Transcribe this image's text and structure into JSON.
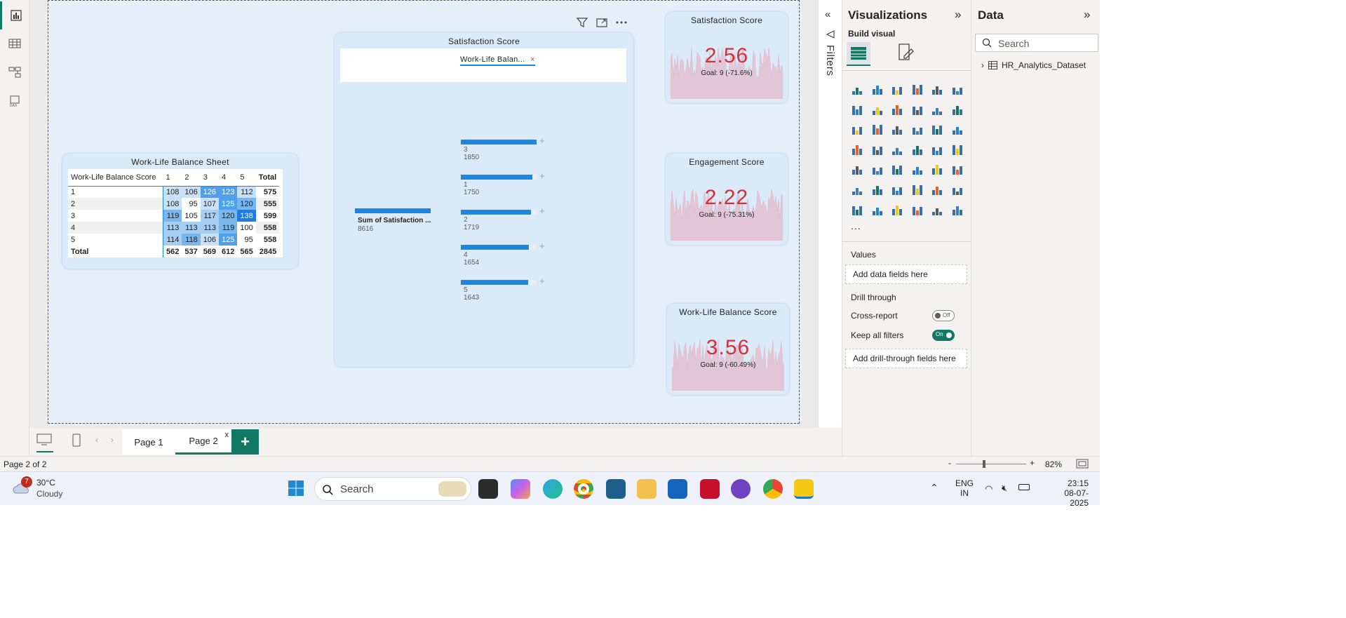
{
  "rail": {
    "items": [
      "report-view",
      "table-view",
      "model-view",
      "dax-query-view"
    ]
  },
  "canvas": {
    "matrix": {
      "title": "Work-Life Balance Sheet",
      "corner": "Work-Life Balance Score",
      "columns": [
        "1",
        "2",
        "3",
        "4",
        "5",
        "Total"
      ],
      "rows": [
        {
          "label": "1",
          "values": [
            "108",
            "106",
            "126",
            "123",
            "112"
          ],
          "total": "575"
        },
        {
          "label": "2",
          "values": [
            "108",
            "95",
            "107",
            "125",
            "120"
          ],
          "total": "555"
        },
        {
          "label": "3",
          "values": [
            "119",
            "105",
            "117",
            "120",
            "138"
          ],
          "total": "599"
        },
        {
          "label": "4",
          "values": [
            "113",
            "113",
            "113",
            "119",
            "100"
          ],
          "total": "558"
        },
        {
          "label": "5",
          "values": [
            "114",
            "118",
            "106",
            "125",
            "95"
          ],
          "total": "558"
        }
      ],
      "total_row": {
        "label": "Total",
        "values": [
          "562",
          "537",
          "569",
          "612",
          "565"
        ],
        "total": "2845"
      }
    },
    "decomp": {
      "title": "Satisfaction Score",
      "filter_chip": "Work-Life Balan...",
      "root": {
        "label": "Sum of Satisfaction ...",
        "value": "8616"
      },
      "nodes": [
        {
          "label": "3",
          "value": "1850",
          "fraction": 1.0
        },
        {
          "label": "1",
          "value": "1750",
          "fraction": 0.946
        },
        {
          "label": "2",
          "value": "1719",
          "fraction": 0.929
        },
        {
          "label": "4",
          "value": "1654",
          "fraction": 0.894
        },
        {
          "label": "5",
          "value": "1643",
          "fraction": 0.888
        }
      ]
    },
    "kpis": [
      {
        "title": "Satisfaction Score",
        "value": "2.56",
        "goal": "Goal: 9 (-71.6%)"
      },
      {
        "title": "Engagement Score",
        "value": "2.22",
        "goal": "Goal: 9 (-75.31%)"
      },
      {
        "title": "Work-Life Balance Score",
        "value": "3.56",
        "goal": "Goal: 9 (-60.49%)"
      }
    ]
  },
  "filters": {
    "label": "Filters"
  },
  "viz": {
    "title": "Visualizations",
    "build": "Build visual",
    "values_label": "Values",
    "values_placeholder": "Add data fields here",
    "drill_label": "Drill through",
    "cross_report": "Cross-report",
    "cross_state": "Off",
    "keep_filters": "Keep all filters",
    "keep_state": "On",
    "drill_placeholder": "Add drill-through fields here",
    "more": "..."
  },
  "data": {
    "title": "Data",
    "search_placeholder": "Search",
    "dataset": "HR_Analytics_Dataset"
  },
  "tabs": {
    "page1": "Page 1",
    "page2": "Page 2",
    "add": "+",
    "close": "x"
  },
  "status": {
    "page": "Page 2 of 2",
    "zoom": "82%",
    "zoom_minus": "-",
    "zoom_plus": "+"
  },
  "taskbar": {
    "temp": "30°C",
    "weather": "Cloudy",
    "weather_badge": "7",
    "search": "Search",
    "lang1": "ENG",
    "lang2": "IN",
    "time": "23:15",
    "date": "08-07-2025"
  },
  "colors": {
    "accent": "#117865",
    "bar": "#1a87e5",
    "kpi_value": "#d13438",
    "canvas": "#e4effa"
  }
}
